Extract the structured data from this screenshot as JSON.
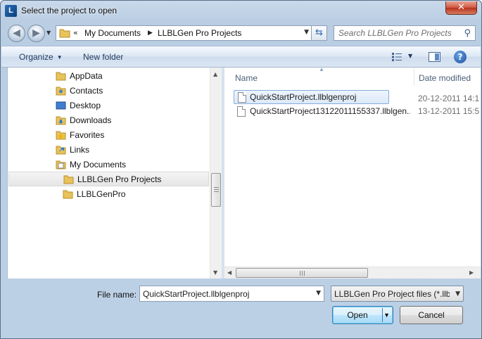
{
  "window": {
    "title": "Select the project to open",
    "app_icon_letter": "L",
    "close_glyph": "✕"
  },
  "nav": {
    "back_glyph": "◀",
    "forward_glyph": "▶",
    "history_drop": "▼"
  },
  "address": {
    "chevrons": "«",
    "crumbs": [
      "My Documents",
      "LLBLGen Pro Projects"
    ],
    "separator": "▶",
    "dropdown": "▼"
  },
  "search": {
    "placeholder": "Search LLBLGen Pro Projects",
    "icon": "search-icon"
  },
  "toolbar": {
    "organize_label": "Organize",
    "new_folder_label": "New folder",
    "help_glyph": "?"
  },
  "tree": {
    "items": [
      {
        "label": "AppData",
        "icon": "folder-icon"
      },
      {
        "label": "Contacts",
        "icon": "contacts-icon"
      },
      {
        "label": "Desktop",
        "icon": "desktop-icon"
      },
      {
        "label": "Downloads",
        "icon": "downloads-icon"
      },
      {
        "label": "Favorites",
        "icon": "favorites-icon"
      },
      {
        "label": "Links",
        "icon": "links-icon"
      },
      {
        "label": "My Documents",
        "icon": "documents-icon"
      },
      {
        "label": "LLBLGen Pro Projects",
        "icon": "folder-icon",
        "selected": true
      },
      {
        "label": "LLBLGenPro",
        "icon": "folder-icon"
      }
    ]
  },
  "list": {
    "columns": [
      "Name",
      "Date modified"
    ],
    "files": [
      {
        "name": "QuickStartProject.llblgenproj",
        "date": "20-12-2011 14:1",
        "selected": true
      },
      {
        "name": "QuickStartProject13122011155337.llblgen...",
        "date": "13-12-2011 15:5",
        "selected": false
      }
    ]
  },
  "bottom": {
    "file_name_label": "File name:",
    "file_name_value": "QuickStartProject.llblgenproj",
    "filter_value": "LLBLGen Pro Project files (*.llbl",
    "open_label": "Open",
    "cancel_label": "Cancel"
  },
  "colors": {
    "accent": "#3c7fb1",
    "folder": "#e8c25a",
    "selection": "#dce9f8"
  }
}
